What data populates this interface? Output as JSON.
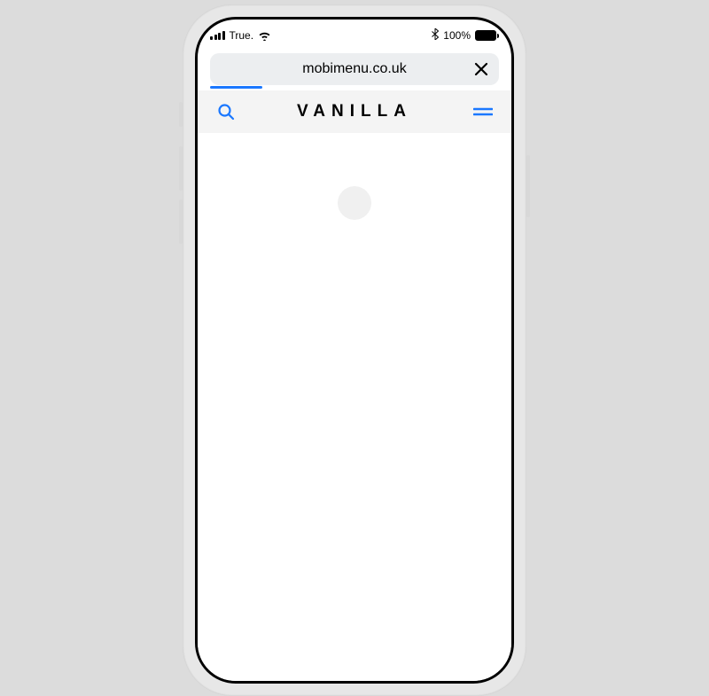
{
  "status_bar": {
    "carrier": "True.",
    "battery_pct": "100%"
  },
  "browser": {
    "url": "mobimenu.co.uk",
    "progress_pct": 18
  },
  "header": {
    "brand": "VANILLA"
  },
  "icons": {
    "signal": "signal-icon",
    "wifi": "wifi-icon",
    "bluetooth": "bluetooth-icon",
    "battery": "battery-icon",
    "close": "close-icon",
    "search": "search-icon",
    "menu": "menu-icon"
  },
  "colors": {
    "accent": "#1b78ff",
    "header_bg": "#f4f4f4",
    "page_bg": "#dcdcdc"
  }
}
